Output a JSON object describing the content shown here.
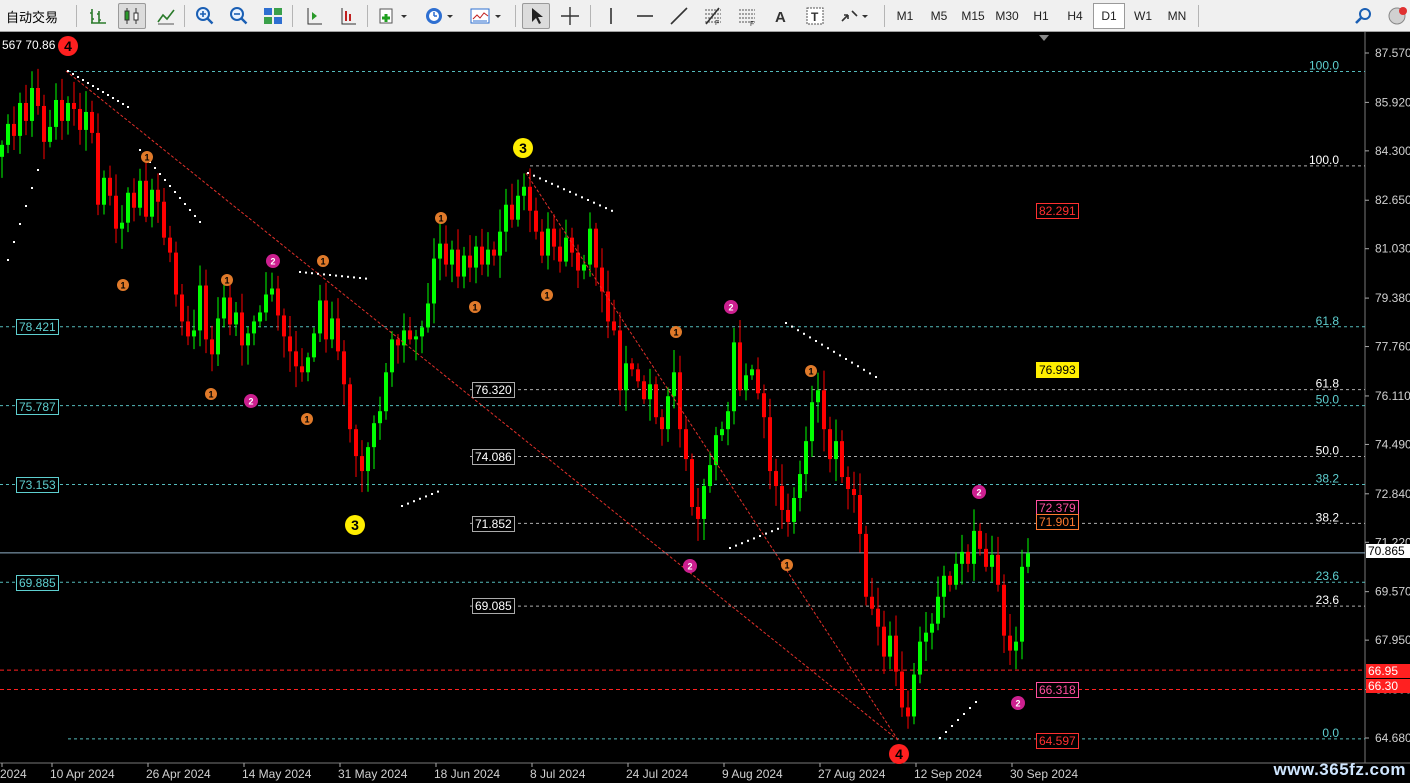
{
  "toolbar": {
    "trade_label": "自动交易",
    "timeframes": [
      "M1",
      "M5",
      "M15",
      "M30",
      "H1",
      "H4",
      "D1",
      "W1",
      "MN"
    ],
    "active_timeframe": "D1",
    "icons": [
      "bar-chart-icon",
      "candlestick-icon",
      "line-chart-icon",
      "zoom-in-icon",
      "zoom-out-icon",
      "tile-windows-icon",
      "chart-shift-icon",
      "auto-scroll-icon",
      "indicators-icon",
      "period-icon",
      "templates-icon",
      "cursor-icon",
      "crosshair-icon",
      "vertical-line-icon",
      "horizontal-line-icon",
      "trendline-icon",
      "fibonacci-icon",
      "fibonacci-fan-icon",
      "text-icon",
      "text-label-icon",
      "arrows-icon",
      "search-icon",
      "alert-icon"
    ]
  },
  "chart": {
    "top_left_text": "567 70.86",
    "price_scale": [
      "87.570",
      "85.920",
      "84.300",
      "82.650",
      "81.030",
      "79.380",
      "77.760",
      "76.110",
      "74.490",
      "72.840",
      "71.220",
      "69.570",
      "67.950",
      "66.300",
      "64.680"
    ],
    "current_price": "70.865",
    "right_red_tags": [
      "66.95",
      "66.30"
    ],
    "date_axis": [
      "2024",
      "10 Apr 2024",
      "26 Apr 2024",
      "14 May 2024",
      "31 May 2024",
      "18 Jun 2024",
      "8 Jul 2024",
      "24 Jul 2024",
      "9 Aug 2024",
      "27 Aug 2024",
      "12 Sep 2024",
      "30 Sep 2024"
    ],
    "fib_levels": [
      "100.0",
      "100.0",
      "61.8",
      "61.8",
      "50.0",
      "50.0",
      "38.2",
      "38.2",
      "23.6",
      "23.6",
      "0.0"
    ],
    "left_labels": [
      "78.421",
      "75.787",
      "73.153",
      "69.885"
    ],
    "mid_labels": [
      "76.320",
      "74.086",
      "71.852",
      "69.085"
    ],
    "right_labels": {
      "upper_red": "82.291",
      "yellow": "76.993",
      "pink": "72.379",
      "orange": "71.901",
      "lower_pink": "66.318",
      "bottom_red": "64.597"
    },
    "wave_markers": {
      "four": "4",
      "three": "3",
      "two": "2",
      "one": "1"
    }
  },
  "colors": {
    "bull": "#00ff00",
    "bear": "#ff0000",
    "fib": "#5ecfd0",
    "grid_white": "#cccccc",
    "wave_orange": "#e07a2a",
    "wave_pink": "#cc1f8f",
    "wave_yellow": "#ffee00",
    "wave_red": "#ff2020"
  },
  "watermark": "www.365fz.com"
}
